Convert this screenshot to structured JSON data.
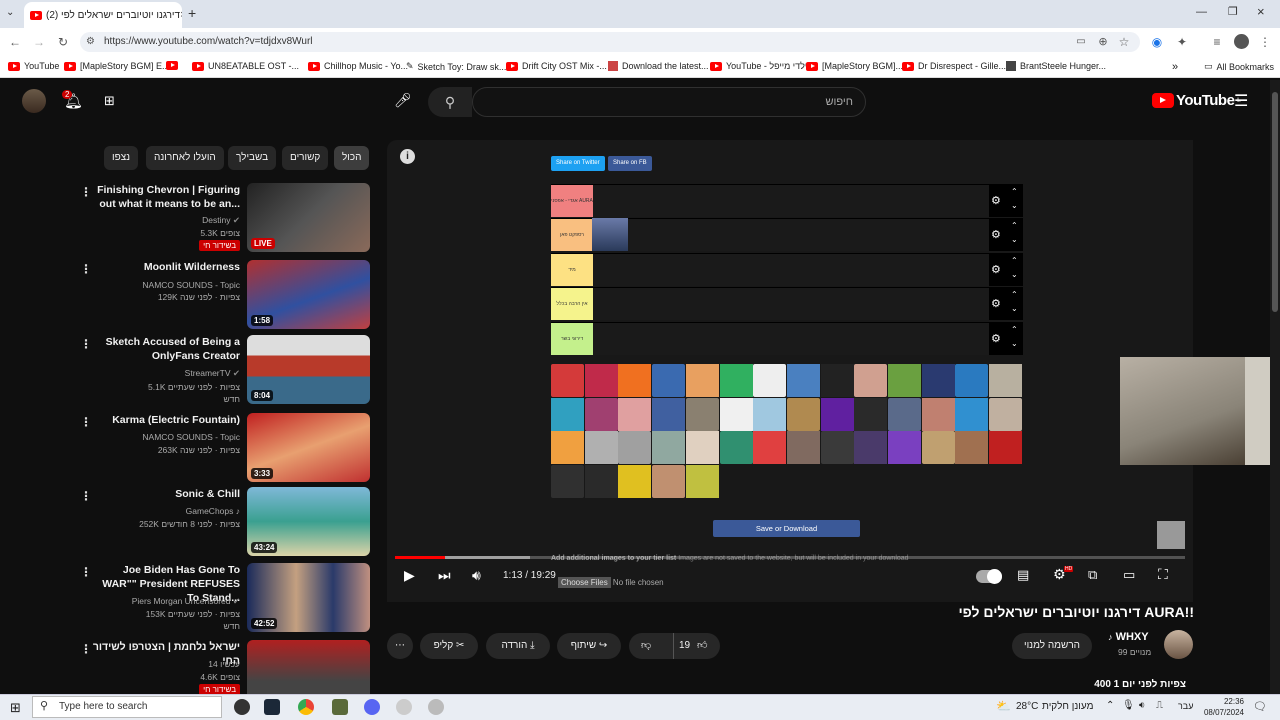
{
  "browser": {
    "tab_title": "(2) דירגנו יוטיוברים ישראלים לפי",
    "url": "https://www.youtube.com/watch?v=tdjdxv8Wurl",
    "bookmarks": [
      "YouTube",
      "[MapleStory BGM] E...",
      "",
      "UN8EATABLE OST -...",
      "Chillhop Music - Yo...",
      "Sketch Toy: Draw sk...",
      "Drift City OST Mix -...",
      "Download the latest...",
      "YouTube - ילדי מייפל",
      "[MapleStory BGM]...",
      "Dr Disrespect - Gille...",
      "BrantSteele Hunger..."
    ],
    "all_bookmarks": "All Bookmarks"
  },
  "youtube": {
    "search_placeholder": "חיפוש",
    "logo_text": "YouTube",
    "logo_region": "IL",
    "notif_count": "2",
    "chips": [
      "הכול",
      "קשורים",
      "בשבילך",
      "הועלו לאחרונה",
      "נצפו"
    ],
    "related": [
      {
        "title": "Finishing Chevron | Figuring out what it means to be an...",
        "channel": "Destiny",
        "views": "5.3K צופים",
        "live": "בשידור חי",
        "badge": "LIVE"
      },
      {
        "title": "Moonlit Wilderness",
        "channel": "NAMCO SOUNDS - Topic",
        "views": "129K צפיות · לפני שנה",
        "duration": "1:58"
      },
      {
        "title": "Sketch Accused of Being a OnlyFans Creator",
        "channel": "StreamerTV",
        "views": "5.1K צפיות · לפני שעתיים",
        "extra": "חדש",
        "duration": "8:04"
      },
      {
        "title": "Karma (Electric Fountain)",
        "channel": "NAMCO SOUNDS - Topic",
        "views": "263K צפיות · לפני שנה",
        "duration": "3:33"
      },
      {
        "title": "Sonic & Chill",
        "channel": "GameChops",
        "views": "252K צפיות · לפני 8 חודשים",
        "duration": "43:24"
      },
      {
        "title": "Joe Biden Has Gone To WAR\"\" President REFUSES To Stand...",
        "channel": "Piers Morgan Uncensored",
        "views": "153K צפיות · לפני שעתיים",
        "extra": "חדש",
        "duration": "42:52"
      },
      {
        "title": "ישראל נלחמת | הצטרפו לשידור החי",
        "channel": "עכשיו 14",
        "views": "4.6K צופים",
        "live": "בשידור חי"
      }
    ],
    "tierlist": {
      "share_twitter": "Share on Twitter",
      "share_fb": "Share on FB",
      "tiers": [
        {
          "label": "אגדי - אפסני AURA",
          "color": "#f08080"
        },
        {
          "label": "רספקט פאן",
          "color": "#f9bf80"
        },
        {
          "label": "מיד",
          "color": "#fde183"
        },
        {
          "label": "אין הרבה בכלל",
          "color": "#f5f38c"
        },
        {
          "label": "דירוגי בשר",
          "color": "#c4f08c"
        }
      ],
      "save_button": "Save or Download",
      "add_images": "Add additional images to your tier list",
      "add_note": "Images are not saved to the website, but will be included in your download",
      "choose_files": "Choose Files",
      "no_file": "No file chosen"
    },
    "player": {
      "time": "1:13 / 19:29",
      "progress": 0.063
    },
    "video": {
      "title": "דירגנו יוטיוברים ישראלים לפי AURA!!",
      "channel": "WHXY",
      "subs": "99 מנויים",
      "subscribe": "הרשמה למנוי",
      "likes": "19",
      "share": "שיתוף",
      "download": "הורדה",
      "clip": "קליפ",
      "views_line": "400 צפיות לפני יום 1"
    }
  },
  "taskbar": {
    "search": "Type here to search",
    "temp": "28°C",
    "weather": "מעונן חלקית",
    "lang": "עבר",
    "time": "22:36",
    "date": "08/07/2024"
  },
  "colors": {
    "yt_red": "#ff0000",
    "bg": "#0f0f0f",
    "tier_btn": "#3b5998",
    "twitter": "#1da1f2"
  }
}
